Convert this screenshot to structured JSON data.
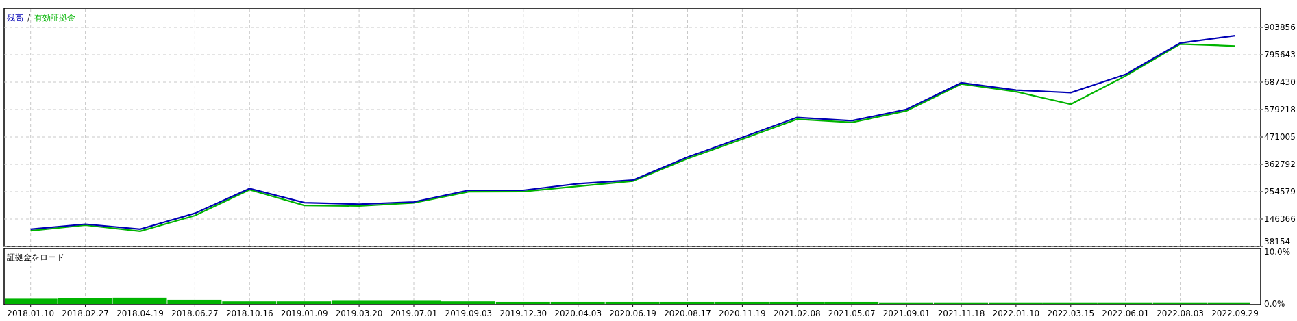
{
  "main_chart": {
    "legend": {
      "separator": "/"
    },
    "chart_data": {
      "type": "line",
      "grid": true,
      "categories": [
        "2018.01.10",
        "2018.02.27",
        "2018.04.19",
        "2018.06.27",
        "2018.10.16",
        "2019.01.09",
        "2019.03.20",
        "2019.07.01",
        "2019.09.03",
        "2019.12.30",
        "2020.04.03",
        "2020.06.19",
        "2020.08.17",
        "2020.11.19",
        "2021.02.08",
        "2021.05.07",
        "2021.09.01",
        "2021.11.18",
        "2022.01.10",
        "2022.03.15",
        "2022.06.01",
        "2022.08.03",
        "2022.09.29"
      ],
      "ylim": [
        38154,
        903856
      ],
      "yticks": [
        38154,
        146366,
        254579,
        362792,
        471005,
        579218,
        687430,
        795643,
        903856
      ],
      "series": [
        {
          "name": "残高",
          "color": "#0000b4",
          "values": [
            106000,
            126000,
            106000,
            169000,
            267000,
            211000,
            205000,
            214000,
            260000,
            260000,
            286000,
            300000,
            391000,
            469000,
            548000,
            535000,
            580000,
            685000,
            656000,
            646000,
            718000,
            842000,
            871000
          ]
        },
        {
          "name": "有効証拠金",
          "color": "#00b400",
          "values": [
            100000,
            122000,
            98000,
            160000,
            262000,
            200000,
            198000,
            210000,
            254000,
            255000,
            276000,
            296000,
            385000,
            462000,
            541000,
            528000,
            574000,
            680000,
            650000,
            600000,
            712000,
            838000,
            830000
          ]
        }
      ]
    }
  },
  "margin_chart": {
    "chart_data": {
      "type": "bar",
      "grid": true,
      "ylim": [
        0,
        10
      ],
      "yticks": [
        {
          "value": 0,
          "label": "0.0%"
        },
        {
          "value": 10,
          "label": "10.0%"
        }
      ],
      "series": [
        {
          "name": "証拠金をロード",
          "color": "#00b400",
          "values": [
            1.0,
            1.1,
            1.2,
            0.8,
            0.5,
            0.5,
            0.6,
            0.6,
            0.5,
            0.4,
            0.4,
            0.4,
            0.4,
            0.4,
            0.4,
            0.4,
            0.3,
            0.3,
            0.3,
            0.3,
            0.3,
            0.3,
            0.3
          ]
        }
      ]
    }
  }
}
